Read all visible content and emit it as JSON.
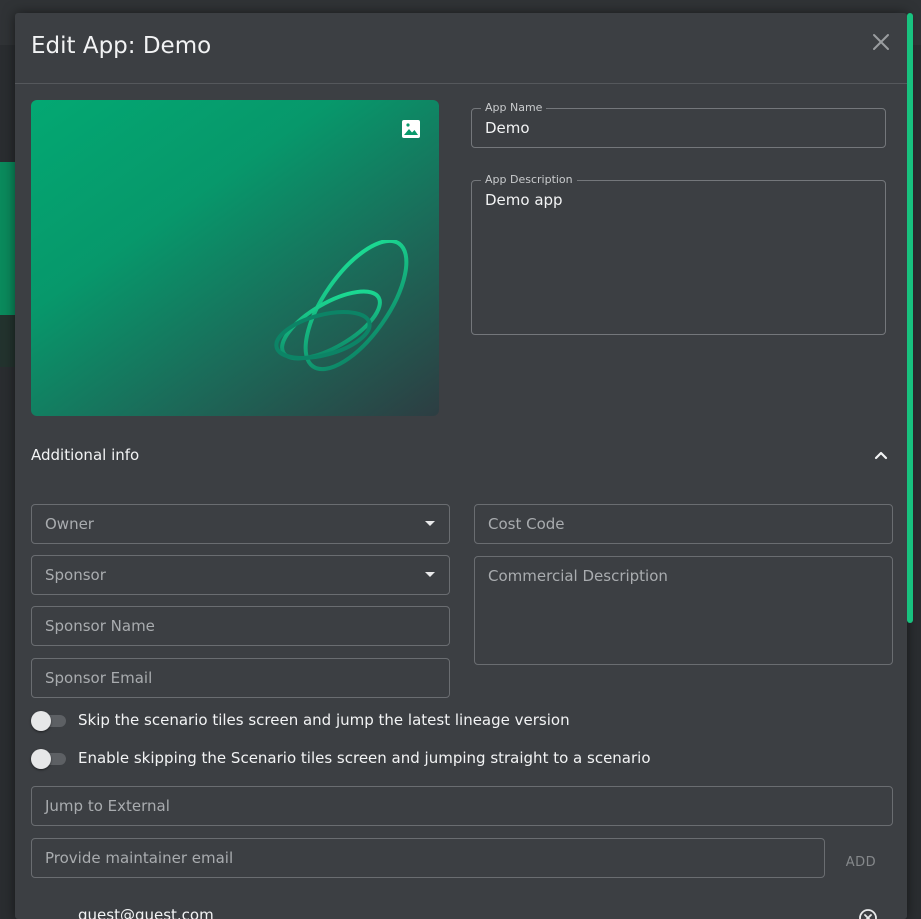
{
  "modal": {
    "title": "Edit App: Demo"
  },
  "app_name": {
    "label": "App Name",
    "value": "Demo"
  },
  "app_description": {
    "label": "App Description",
    "value": "Demo app"
  },
  "additional_info": {
    "title": "Additional info",
    "owner": {
      "placeholder": "Owner"
    },
    "sponsor": {
      "placeholder": "Sponsor"
    },
    "sponsor_name": {
      "placeholder": "Sponsor Name"
    },
    "sponsor_email": {
      "placeholder": "Sponsor Email"
    },
    "cost_code": {
      "placeholder": "Cost Code"
    },
    "commercial_description": {
      "placeholder": "Commercial Description"
    }
  },
  "toggles": [
    {
      "label": "Skip the scenario tiles screen and jump the latest lineage version",
      "checked": false
    },
    {
      "label": "Enable skipping the Scenario tiles screen and jumping straight to a scenario",
      "checked": false
    }
  ],
  "jump_to_external": {
    "placeholder": "Jump to External"
  },
  "maintainer": {
    "placeholder": "Provide maintainer email",
    "add_label": "ADD",
    "items": [
      "guest@guest.com"
    ]
  },
  "icons": {
    "close": "close-icon",
    "image": "image-icon",
    "collapse": "chevron-up-icon",
    "dropdown": "caret-down-icon",
    "remove": "remove-circle-icon"
  },
  "colors": {
    "modal_bg": "#3c3f43",
    "accent": "#18c27f",
    "hero_gradient_start": "#03a872"
  }
}
